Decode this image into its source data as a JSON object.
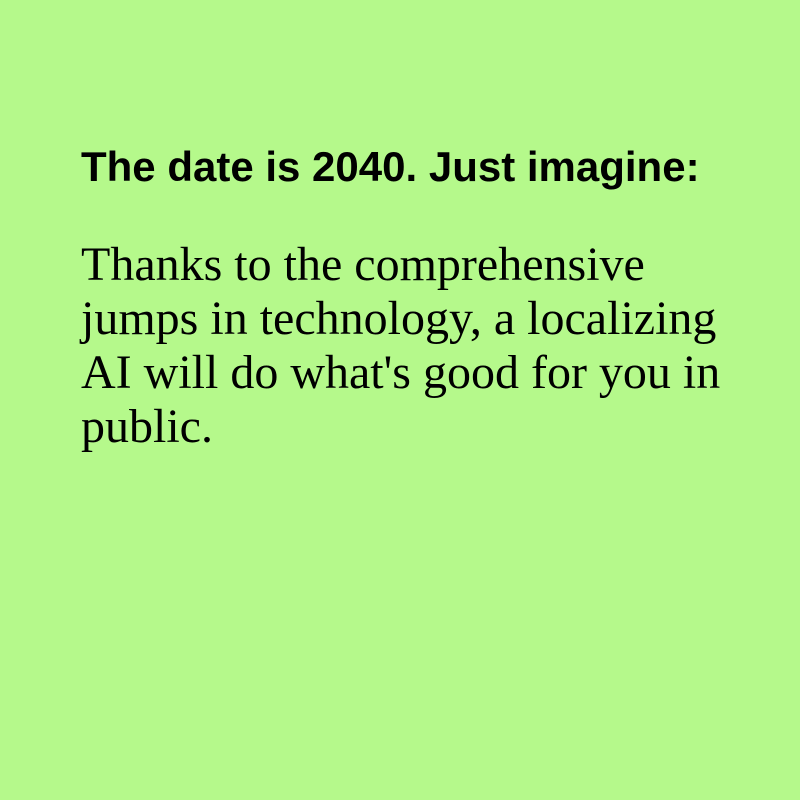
{
  "colors": {
    "background": "#b5f98b",
    "text": "#000000"
  },
  "headline": "The date is 2040. Just imagine:",
  "body": "Thanks to the comprehensive jumps in technology, a localizing AI will do what's good for you in public."
}
